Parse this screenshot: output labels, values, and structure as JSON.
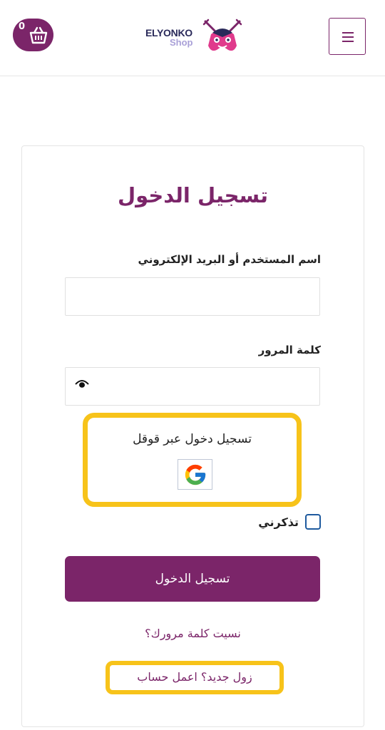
{
  "header": {
    "cart_count": "0",
    "logo_line1": "ELYONKO",
    "logo_line2": "Shop"
  },
  "login": {
    "title": "تسجيل الدخول",
    "username_label": "اسم المستخدم أو البريد الإلكتروني",
    "username_value": "",
    "password_label": "كلمة المرور",
    "password_value": "",
    "google_label": "تسجيل دخول عبر قوقل",
    "remember_label": "تذكرني",
    "remember_checked": false,
    "submit_label": "تسجيل الدخول",
    "forgot_label": "نسيت كلمة مرورك؟",
    "signup_label": "زول جديد؟ اعمل حساب"
  },
  "colors": {
    "brand": "#7b2569",
    "highlight": "#f7c31a"
  }
}
